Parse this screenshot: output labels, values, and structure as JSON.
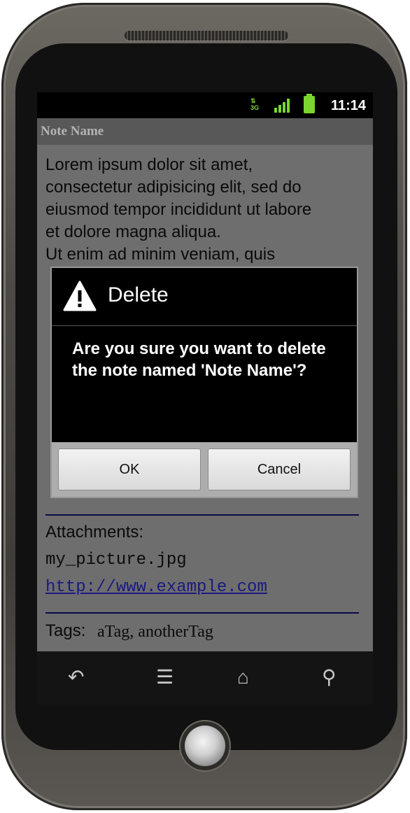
{
  "status_bar": {
    "time": "11:14",
    "network": "3G",
    "network_icon": "network-3g-icon",
    "signal_icon": "signal-icon",
    "battery_icon": "battery-icon"
  },
  "title_bar": {
    "title": "Note Name"
  },
  "note": {
    "body_lines": [
      "Lorem ipsum dolor sit amet,",
      "consectetur adipisicing elit, sed do",
      "eiusmod tempor incididunt ut labore",
      "et dolore magna aliqua.",
      "Ut enim ad minim veniam, quis"
    ],
    "attachments_label": "Attachments:",
    "attachment_file": "my_picture.jpg",
    "attachment_link": "http://www.example.com",
    "tags_label": "Tags:",
    "tags_values": "aTag, anotherTag"
  },
  "dialog": {
    "title": "Delete",
    "icon": "warning-icon",
    "message": "Are you sure you want to delete the note named 'Note Name'?",
    "ok_label": "OK",
    "cancel_label": "Cancel"
  },
  "nav_bar": {
    "icons": [
      "back-icon",
      "menu-icon",
      "home-icon",
      "search-icon"
    ]
  },
  "colors": {
    "screen_dim": "#6e6e6e",
    "status_green": "#7bd530",
    "link": "#1a1a80"
  }
}
